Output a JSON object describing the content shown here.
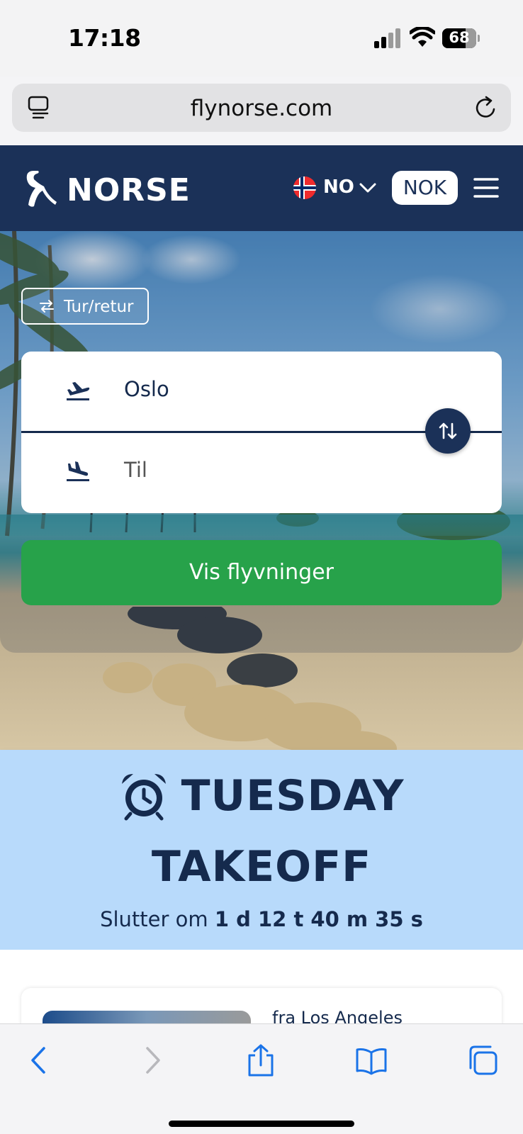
{
  "status_bar": {
    "time": "17:18",
    "battery_percent": 68,
    "battery_label": "68",
    "icons": [
      "signal-icon",
      "wifi-icon",
      "battery-icon"
    ]
  },
  "browser": {
    "url": "flynorse.com",
    "icons": [
      "tabs-overview-icon",
      "reload-icon"
    ]
  },
  "header": {
    "logo_text": "NORSE",
    "language_code": "NO",
    "currency": "NOK",
    "colors": {
      "background": "#1b3158",
      "text": "#ffffff"
    }
  },
  "search": {
    "trip_type_label": "Tur/retur",
    "from_value": "Oslo",
    "to_placeholder": "Til",
    "submit_label": "Vis flyvninger",
    "colors": {
      "cta": "#27a24a",
      "accent": "#1b3158"
    }
  },
  "promo": {
    "title_line1": "TUESDAY",
    "title_line2": "TAKEOFF",
    "countdown_prefix": "Slutter om",
    "countdown_value": "1 d 12 t 40 m 35 s",
    "colors": {
      "background": "#b8dafb"
    }
  },
  "deal": {
    "from_text": "fra Los Angeles"
  },
  "toolbar": {
    "icons": [
      "back-icon",
      "forward-icon",
      "share-icon",
      "bookmarks-icon",
      "tabs-icon"
    ]
  }
}
